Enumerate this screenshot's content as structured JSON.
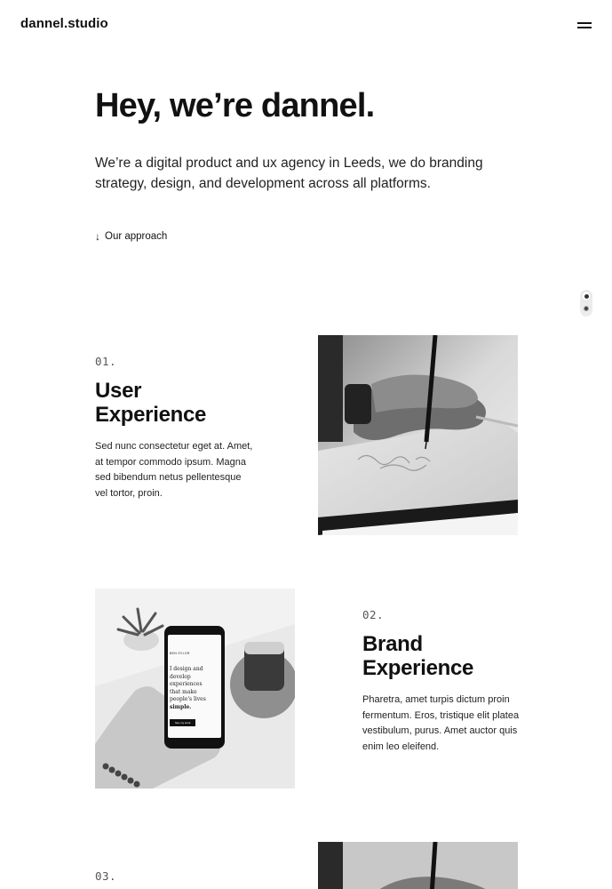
{
  "header": {
    "logo": "dannel.studio",
    "menu_icon": "hamburger-icon"
  },
  "hero": {
    "title": "Hey, we’re dannel.",
    "text": "We’re a digital product and ux agency in Leeds, we do branding strategy, design, and development across all platforms.",
    "link_arrow": "↓",
    "link_label": "Our approach"
  },
  "theme_toggle": {
    "icons": [
      "moon-icon",
      "sun-icon"
    ]
  },
  "sections": [
    {
      "number": "01.",
      "title_line1": "User",
      "title_line2": "Experience",
      "text": "Sed nunc consectetur eget at. Amet, at tempor commodo ipsum. Magna sed bibendum netus pellentesque vel tortor, proin.",
      "image": "hand-drawing-sketch-photo"
    },
    {
      "number": "02.",
      "title_line1": "Brand",
      "title_line2": "Experience",
      "text": "Pharetra, amet turpis dictum proin fermentum. Eros, tristique elit platea vestibulum, purus. Amet auctor quis enim leo eleifend.",
      "image": "phone-in-hand-photo",
      "phone_screen": {
        "brand": "BEN SYLOR",
        "headline_lines": [
          "I design and",
          "develop",
          "experiences",
          "that make",
          "people's lives"
        ],
        "headline_emphasis": "simple.",
        "button": "See my work"
      }
    },
    {
      "number": "03.",
      "image": "hand-drawing-sketch-photo"
    }
  ],
  "colors": {
    "text": "#111111",
    "background": "#ffffff",
    "muted": "#555555"
  }
}
